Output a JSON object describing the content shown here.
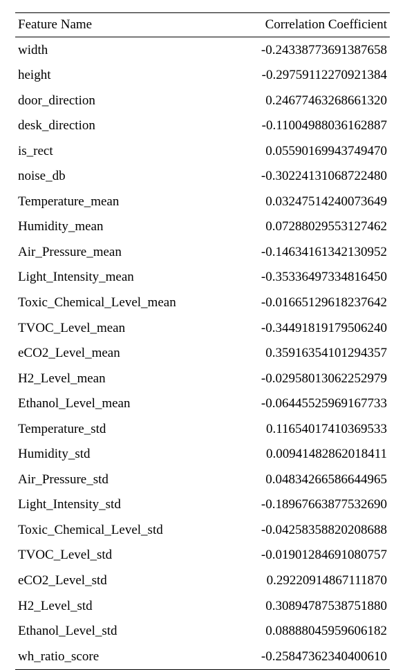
{
  "chart_data": {
    "type": "table",
    "columns": [
      "Feature Name",
      "Correlation Coefficient"
    ],
    "rows": [
      {
        "name": "width",
        "value": "-0.24338773691387658"
      },
      {
        "name": "height",
        "value": "-0.29759112270921384"
      },
      {
        "name": "door_direction",
        "value": "0.24677463268661320"
      },
      {
        "name": "desk_direction",
        "value": "-0.11004988036162887"
      },
      {
        "name": "is_rect",
        "value": "0.05590169943749470"
      },
      {
        "name": "noise_db",
        "value": "-0.30224131068722480"
      },
      {
        "name": "Temperature_mean",
        "value": "0.03247514240073649"
      },
      {
        "name": "Humidity_mean",
        "value": "0.07288029553127462"
      },
      {
        "name": "Air_Pressure_mean",
        "value": "-0.14634161342130952"
      },
      {
        "name": "Light_Intensity_mean",
        "value": "-0.35336497334816450"
      },
      {
        "name": "Toxic_Chemical_Level_mean",
        "value": "-0.01665129618237642"
      },
      {
        "name": "TVOC_Level_mean",
        "value": "-0.34491819179506240"
      },
      {
        "name": "eCO2_Level_mean",
        "value": "0.35916354101294357"
      },
      {
        "name": "H2_Level_mean",
        "value": "-0.02958013062252979"
      },
      {
        "name": "Ethanol_Level_mean",
        "value": "-0.06445525969167733"
      },
      {
        "name": "Temperature_std",
        "value": "0.11654017410369533"
      },
      {
        "name": "Humidity_std",
        "value": "0.00941482862018411"
      },
      {
        "name": "Air_Pressure_std",
        "value": "0.04834266586644965"
      },
      {
        "name": "Light_Intensity_std",
        "value": "-0.18967663877532690"
      },
      {
        "name": "Toxic_Chemical_Level_std",
        "value": "-0.04258358820208688"
      },
      {
        "name": "TVOC_Level_std",
        "value": "-0.01901284691080757"
      },
      {
        "name": "eCO2_Level_std",
        "value": "0.29220914867111870"
      },
      {
        "name": "H2_Level_std",
        "value": "0.30894787538751880"
      },
      {
        "name": "Ethanol_Level_std",
        "value": "0.08888045959606182"
      },
      {
        "name": "wh_ratio_score",
        "value": "-0.25847362340400610"
      }
    ]
  }
}
